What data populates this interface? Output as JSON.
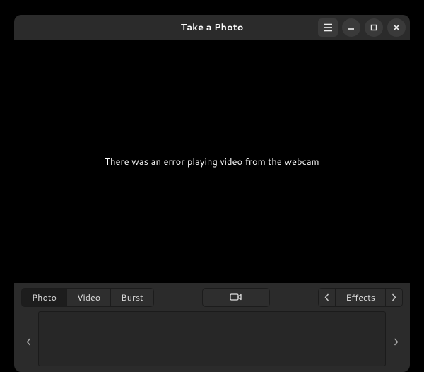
{
  "header": {
    "title": "Take a Photo"
  },
  "content": {
    "error_message": "There was an error playing video from the webcam"
  },
  "toolbar": {
    "modes": [
      {
        "label": "Photo",
        "active": true
      },
      {
        "label": "Video",
        "active": false
      },
      {
        "label": "Burst",
        "active": false
      }
    ],
    "effects_label": "Effects"
  }
}
